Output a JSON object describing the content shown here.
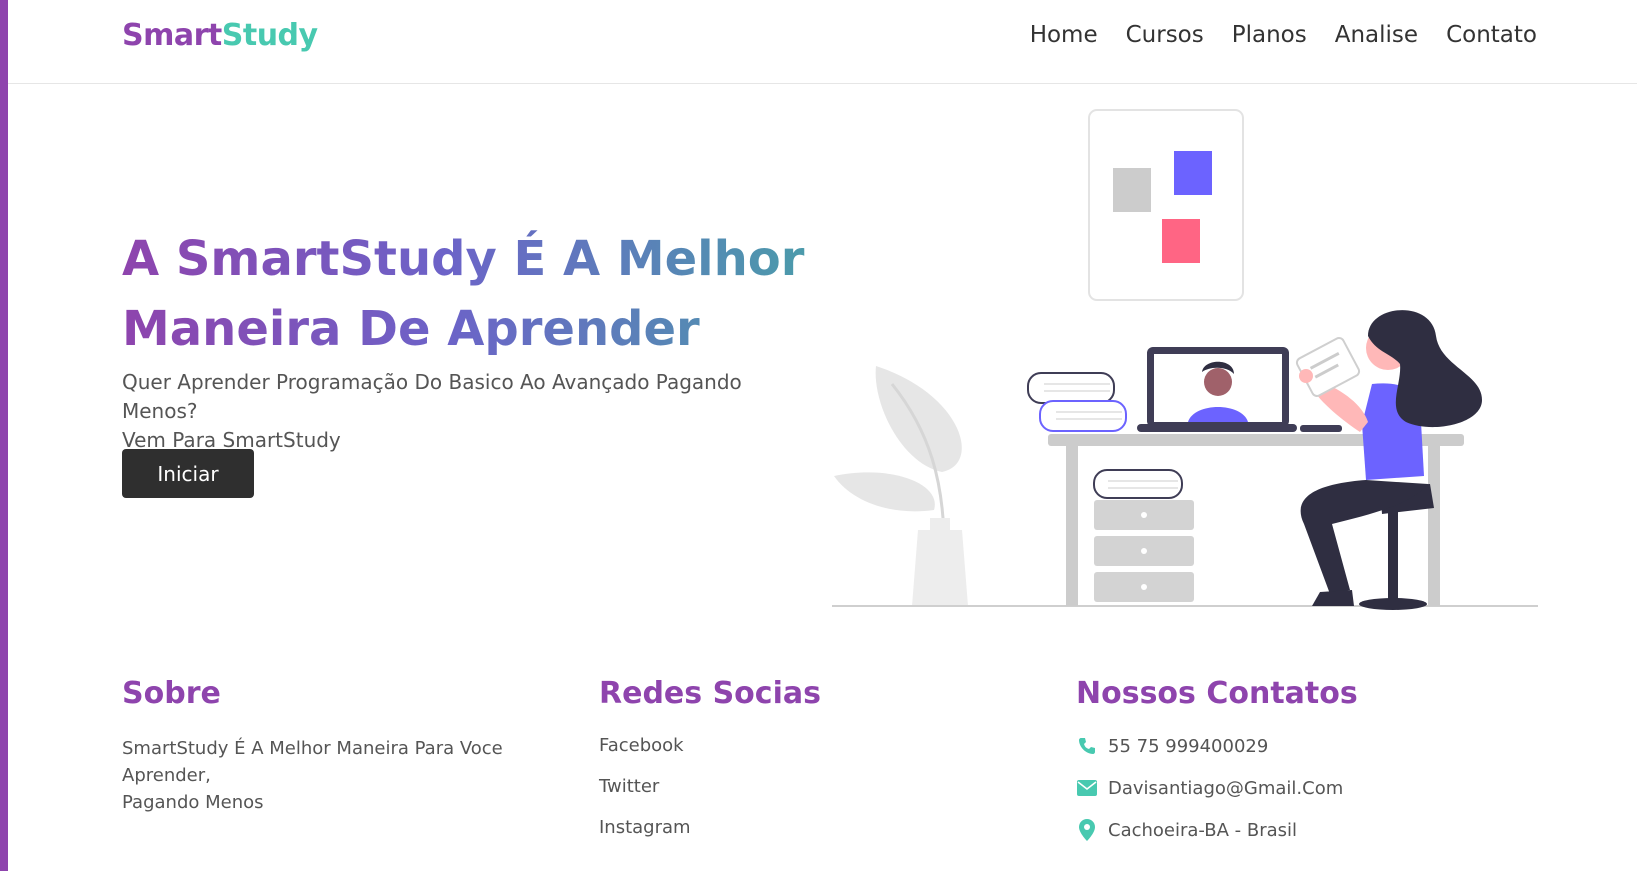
{
  "brand": {
    "part1": "Smart",
    "part2": "Study"
  },
  "nav": {
    "items": [
      {
        "label": "Home"
      },
      {
        "label": "Cursos"
      },
      {
        "label": "Planos"
      },
      {
        "label": "Analise"
      },
      {
        "label": "Contato"
      }
    ]
  },
  "hero": {
    "title_line1": "A SmartStudy É A Melhor",
    "title_line2": "Maneira De Aprender",
    "subtitle_line1": "Quer Aprender Programação Do Basico Ao Avançado Pagando Menos?",
    "subtitle_line2": "Vem Para SmartStudy",
    "button_label": "Iniciar"
  },
  "footer": {
    "about": {
      "heading": "Sobre",
      "text_line1": "SmartStudy É A Melhor Maneira Para Voce Aprender,",
      "text_line2": "Pagando Menos"
    },
    "social": {
      "heading": "Redes Socias",
      "links": [
        {
          "label": "Facebook"
        },
        {
          "label": "Twitter"
        },
        {
          "label": "Instagram"
        }
      ]
    },
    "contact": {
      "heading": "Nossos Contatos",
      "items": [
        {
          "icon": "phone-icon",
          "text": "55 75 999400029"
        },
        {
          "icon": "envelope-icon",
          "text": "Davisantiago@Gmail.Com"
        },
        {
          "icon": "map-marker-icon",
          "text": "Cachoeira-BA - Brasil"
        }
      ]
    }
  },
  "colors": {
    "brand_purple": "#8e44ad",
    "brand_teal": "#48c9b0",
    "button_dark": "#2f2f2f",
    "illustration_accent": "#6c63ff",
    "illustration_pink": "#ff6584"
  }
}
